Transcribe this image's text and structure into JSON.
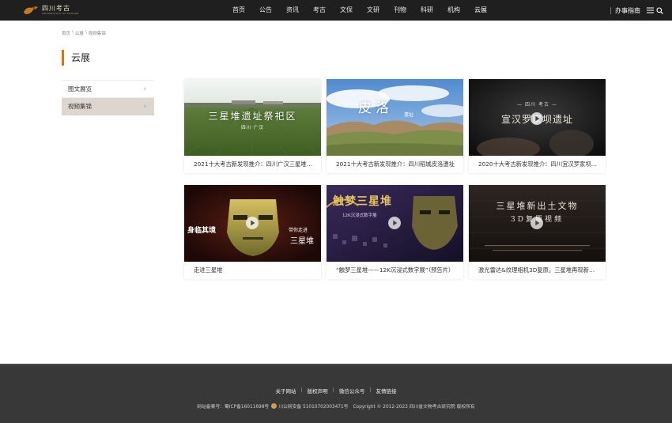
{
  "header": {
    "logo_text": "四川考古",
    "logo_subtext": "ARCHAEOLOGY OF SICHUAN",
    "nav": [
      "首页",
      "公告",
      "资讯",
      "考古",
      "文保",
      "文研",
      "刊物",
      "科研",
      "机构",
      "云展"
    ],
    "active_nav": "云展",
    "guide_label": "办事指南"
  },
  "breadcrumb": [
    "首页",
    "云展",
    "视频集锦"
  ],
  "breadcrumb_sep": "\\",
  "page_title": "云展",
  "sidebar": {
    "items": [
      {
        "label": "图文展览",
        "active": false
      },
      {
        "label": "视频集锦",
        "active": true
      }
    ]
  },
  "cards": [
    {
      "caption": "2021十大考古新发现推介：四川广汉三星堆遗址祭祀区",
      "overlay_title": "三星堆遗址祭祀区",
      "overlay_sub": "四川·广汉",
      "play": true
    },
    {
      "caption": "2021十大考古新发现推介：四川稻城皮洛遗址",
      "overlay_title": "皮洛",
      "overlay_sub": "遗址",
      "play": false
    },
    {
      "caption": "2020十大考古新发现推介：四川宜汉罗家坝遗址",
      "overlay_title": "宣汉罗家坝遗址",
      "overlay_sub": "— 四川 考古 —",
      "play": true
    },
    {
      "caption": "走进三星堆",
      "overlay_title": "三星堆",
      "overlay_sub": "身临其境",
      "overlay_sub2": "带你走进",
      "play": true
    },
    {
      "caption": "“触梦三星堆——12K沉浸式数字展”（预告片）",
      "overlay_title": "触梦三星堆",
      "overlay_sub": "12K沉浸式数字展",
      "play": true
    },
    {
      "caption": "激光雷达&纹理相机3D复原。三星堆再现新出土文物",
      "overlay_title": "三星堆新出土文物",
      "overlay_sub": "3D复原视频",
      "play": true
    }
  ],
  "footer": {
    "links": [
      "关于网站",
      "版权声明",
      "微信公众号",
      "友情链接"
    ],
    "icp": "网站备案号：蜀ICP备16011698号",
    "police": "川公网安备 51010702003471号",
    "copyright": "Copyright © 2012-2023 四川省文物考古研究院 版权所有"
  },
  "colors": {
    "accent": "#c8781e",
    "header_bg": "#1f1f1f",
    "footer_bg": "#383838",
    "sidebar_active_bg": "#ddd6cf"
  }
}
